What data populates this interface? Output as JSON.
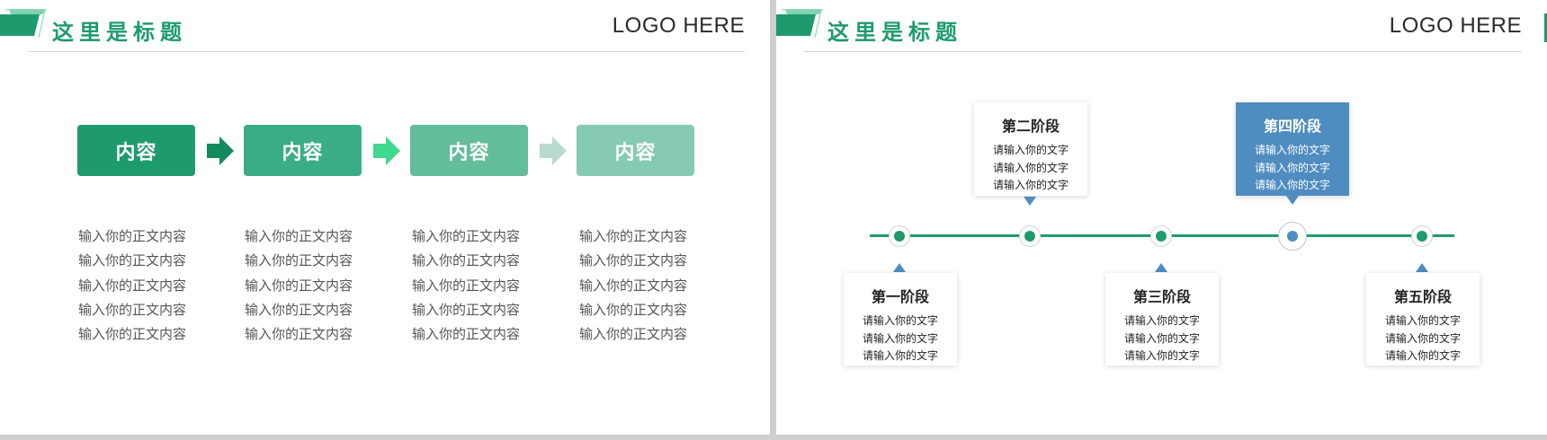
{
  "slides": [
    {
      "header": {
        "title": "这里是标题",
        "logo": "LOGO HERE"
      },
      "steps": [
        {
          "label": "内容",
          "color": "#1e9b6c",
          "text": [
            "输入你的正文内容",
            "输入你的正文内容",
            "输入你的正文内容",
            "输入你的正文内容",
            "输入你的正文内容"
          ]
        },
        {
          "label": "内容",
          "color": "#3aad84",
          "text": [
            "输入你的正文内容",
            "输入你的正文内容",
            "输入你的正文内容",
            "输入你的正文内容",
            "输入你的正文内容"
          ]
        },
        {
          "label": "内容",
          "color": "#63bd9a",
          "text": [
            "输入你的正文内容",
            "输入你的正文内容",
            "输入你的正文内容",
            "输入你的正文内容",
            "输入你的正文内容"
          ]
        },
        {
          "label": "内容",
          "color": "#86cab1",
          "text": [
            "输入你的正文内容",
            "输入你的正文内容",
            "输入你的正文内容",
            "输入你的正文内容",
            "输入你的正文内容"
          ]
        }
      ],
      "arrow_colors": [
        "#128a5d",
        "#3ed88f",
        "#b9d9cc"
      ]
    },
    {
      "header": {
        "title": "这里是标题",
        "logo": "LOGO HERE"
      },
      "stages": [
        {
          "title": "第一阶段",
          "lines": [
            "请输入你的文字",
            "请输入你的文字",
            "请输入你的文字"
          ]
        },
        {
          "title": "第二阶段",
          "lines": [
            "请输入你的文字",
            "请输入你的文字",
            "请输入你的文字"
          ]
        },
        {
          "title": "第三阶段",
          "lines": [
            "请输入你的文字",
            "请输入你的文字",
            "请输入你的文字"
          ]
        },
        {
          "title": "第四阶段",
          "lines": [
            "请输入你的文字",
            "请输入你的文字",
            "请输入你的文字"
          ]
        },
        {
          "title": "第五阶段",
          "lines": [
            "请输入你的文字",
            "请输入你的文字",
            "请输入你的文字"
          ]
        }
      ],
      "colors": {
        "green": "#1e9b6c",
        "blue": "#4f8cbf"
      }
    }
  ]
}
